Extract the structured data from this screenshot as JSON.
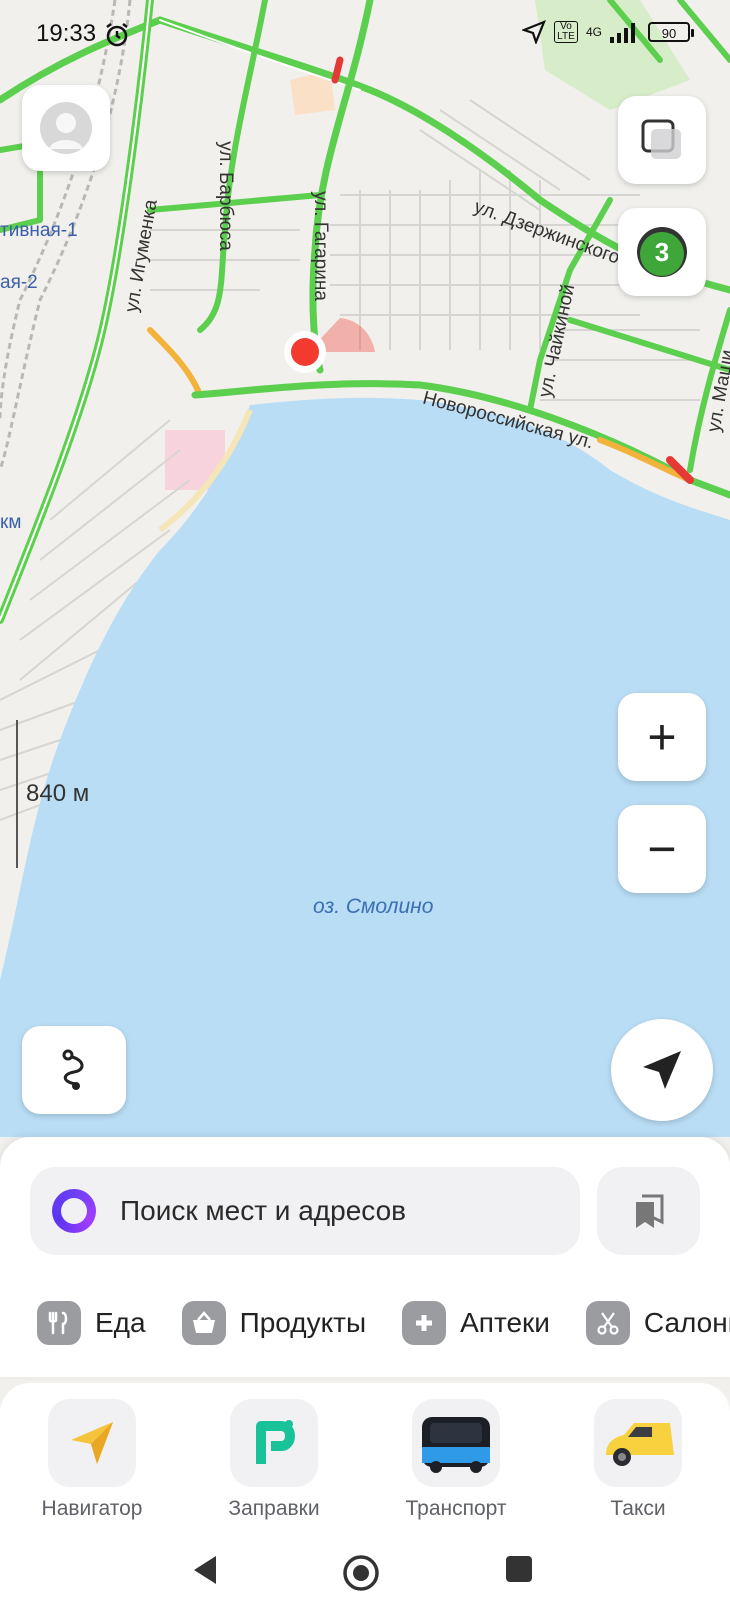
{
  "status_bar": {
    "time": "19:33",
    "network": "4G",
    "volte": "Vo LTE",
    "battery": "90"
  },
  "map": {
    "streets": [
      "ул. Игуменка",
      "ул. Барбюса",
      "ул. Гагарина",
      "ул. Дзержинского",
      "ул. Чайкиной",
      "Новороссийская ул.",
      "ул. Маши"
    ],
    "partial_labels": [
      "тивная-1",
      "ая-2",
      "км"
    ],
    "lake": "оз. Смолино",
    "scale": "840 м",
    "traffic_badge": "3"
  },
  "controls": {
    "profile": "avatar-icon",
    "layers": "layers-icon",
    "zoom_in": "+",
    "zoom_out": "−",
    "route": "route-icon",
    "locate": "location-arrow-icon"
  },
  "search": {
    "placeholder": "Поиск мест и адресов"
  },
  "categories": [
    {
      "label": "Еда",
      "icon": "fork-knife-icon"
    },
    {
      "label": "Продукты",
      "icon": "basket-icon"
    },
    {
      "label": "Аптеки",
      "icon": "pharmacy-cross-icon"
    },
    {
      "label": "Салоны",
      "icon": "scissors-icon"
    }
  ],
  "apps": [
    {
      "label": "Навигатор",
      "icon": "navigator-icon"
    },
    {
      "label": "Заправки",
      "icon": "fuel-icon"
    },
    {
      "label": "Транспорт",
      "icon": "bus-icon"
    },
    {
      "label": "Такси",
      "icon": "taxi-icon"
    }
  ],
  "colors": {
    "water": "#b9ddf5",
    "road_green": "#5ccf4e",
    "road_yellow": "#f3b23a",
    "road_red": "#e53935",
    "alice_purple": "#6b3ff5",
    "location_red": "#f23a2f"
  }
}
